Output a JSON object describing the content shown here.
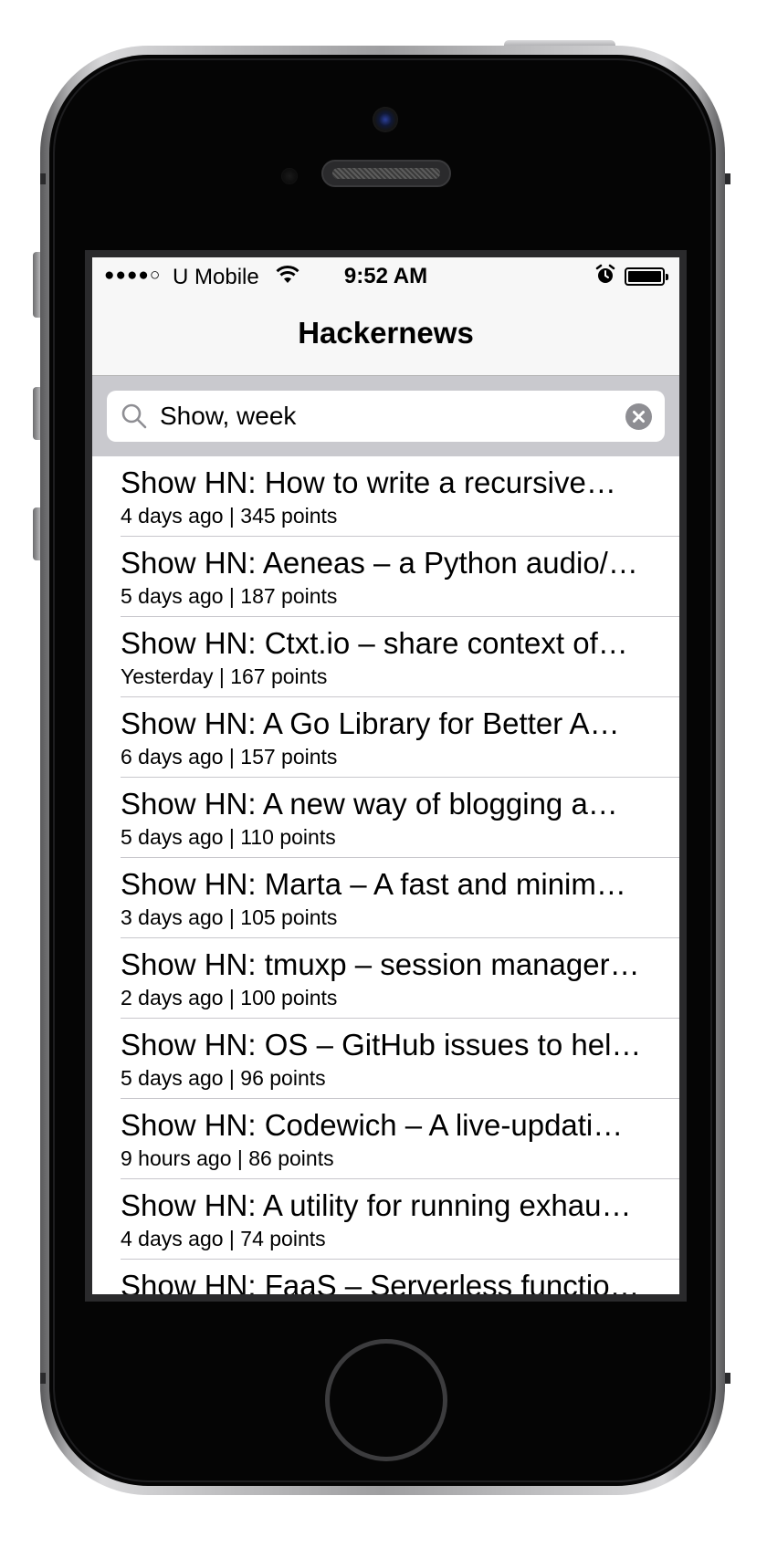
{
  "status_bar": {
    "signal": "●●●●○",
    "carrier": "U Mobile",
    "time": "9:52 AM"
  },
  "nav": {
    "title": "Hackernews"
  },
  "search": {
    "value": "Show, week"
  },
  "stories": [
    {
      "title": "Show HN: How to write a recursive…",
      "meta": "4 days ago | 345 points"
    },
    {
      "title": "Show HN: Aeneas – a Python audio/…",
      "meta": "5 days ago | 187 points"
    },
    {
      "title": "Show HN: Ctxt.io – share context of…",
      "meta": "Yesterday | 167 points"
    },
    {
      "title": "Show HN: A Go Library for Better A…",
      "meta": "6 days ago | 157 points"
    },
    {
      "title": "Show HN: A new way of blogging a…",
      "meta": "5 days ago | 110 points"
    },
    {
      "title": "Show HN: Marta – A fast and minim…",
      "meta": "3 days ago | 105 points"
    },
    {
      "title": "Show HN: tmuxp – session manager…",
      "meta": "2 days ago | 100 points"
    },
    {
      "title": "Show HN: OS – GitHub issues to hel…",
      "meta": "5 days ago | 96 points"
    },
    {
      "title": "Show HN: Codewich – A live-updati…",
      "meta": "9 hours ago | 86 points"
    },
    {
      "title": "Show HN: A utility for running exhau…",
      "meta": "4 days ago | 74 points"
    },
    {
      "title": "Show HN: FaaS – Serverless functio…",
      "meta": ""
    }
  ]
}
